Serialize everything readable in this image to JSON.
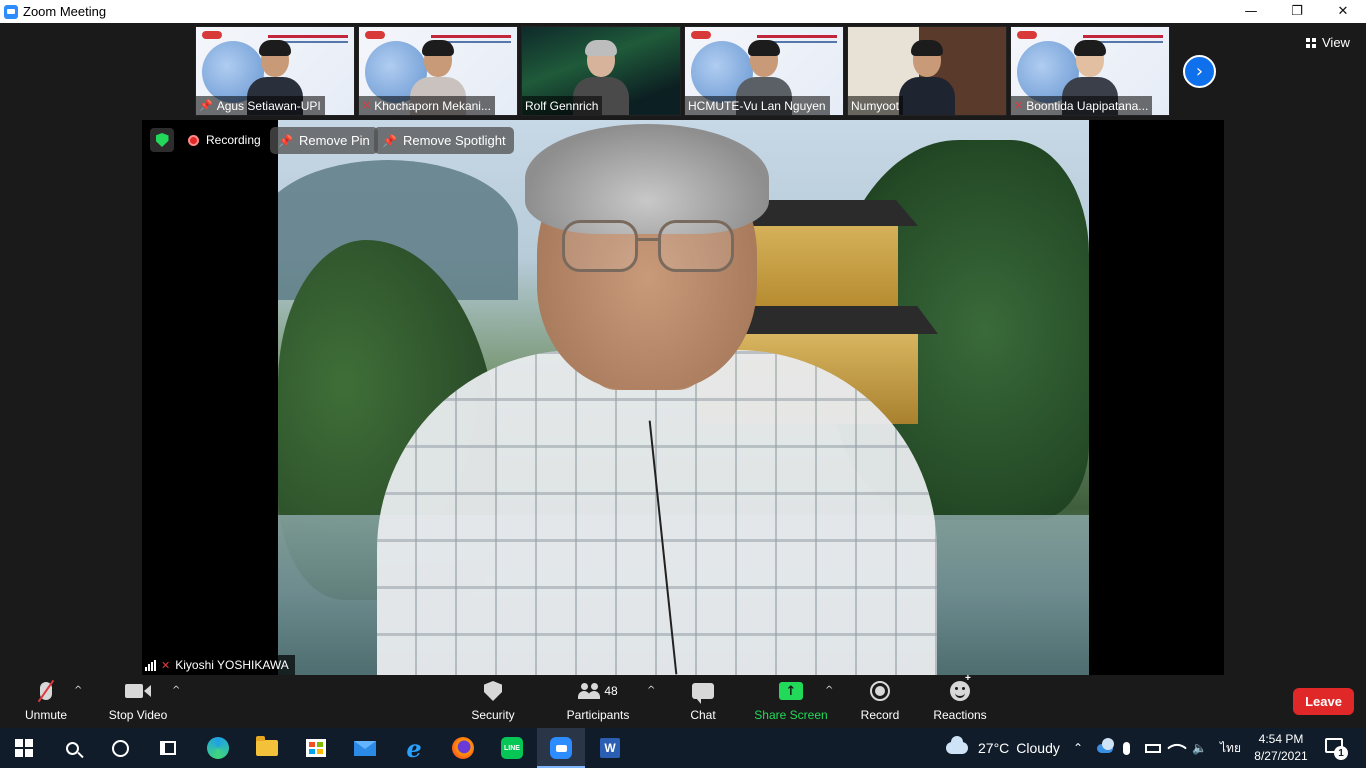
{
  "window": {
    "title": "Zoom Meeting",
    "minimize": "—",
    "maximize": "❐",
    "close": "✕"
  },
  "top": {
    "view_label": "View",
    "next_page": "›"
  },
  "thumbnails": [
    {
      "name": "Agus Setiawan-UPI",
      "pinned": true,
      "muted": false
    },
    {
      "name": "Khochaporn Mekani...",
      "pinned": false,
      "muted": true
    },
    {
      "name": "Rolf Gennrich",
      "pinned": false,
      "muted": false
    },
    {
      "name": "HCMUTE-Vu Lan Nguyen",
      "pinned": false,
      "muted": false
    },
    {
      "name": "Numyoot",
      "pinned": false,
      "muted": false
    },
    {
      "name": "Boontida Uapipatana...",
      "pinned": false,
      "muted": true
    }
  ],
  "main_video": {
    "recording_label": "Recording",
    "remove_pin_label": "Remove Pin",
    "remove_spotlight_label": "Remove Spotlight",
    "speaker_name": "Kiyoshi YOSHIKAWA"
  },
  "controls": {
    "unmute": "Unmute",
    "stop_video": "Stop Video",
    "security": "Security",
    "participants": "Participants",
    "participants_count": "48",
    "chat": "Chat",
    "share_screen": "Share Screen",
    "record": "Record",
    "reactions": "Reactions",
    "leave": "Leave",
    "caret": "^"
  },
  "taskbar": {
    "weather_temp": "27°C",
    "weather_desc": "Cloudy",
    "language": "ไทย",
    "time": "4:54 PM",
    "date": "8/27/2021",
    "notification_count": "1",
    "tray_up": "⌃",
    "line_label": "LINE",
    "word_label": "W"
  },
  "colors": {
    "accent_blue": "#0e71eb",
    "share_green": "#23d959",
    "leave_red": "#e02828",
    "muted_red": "#e0383e"
  }
}
